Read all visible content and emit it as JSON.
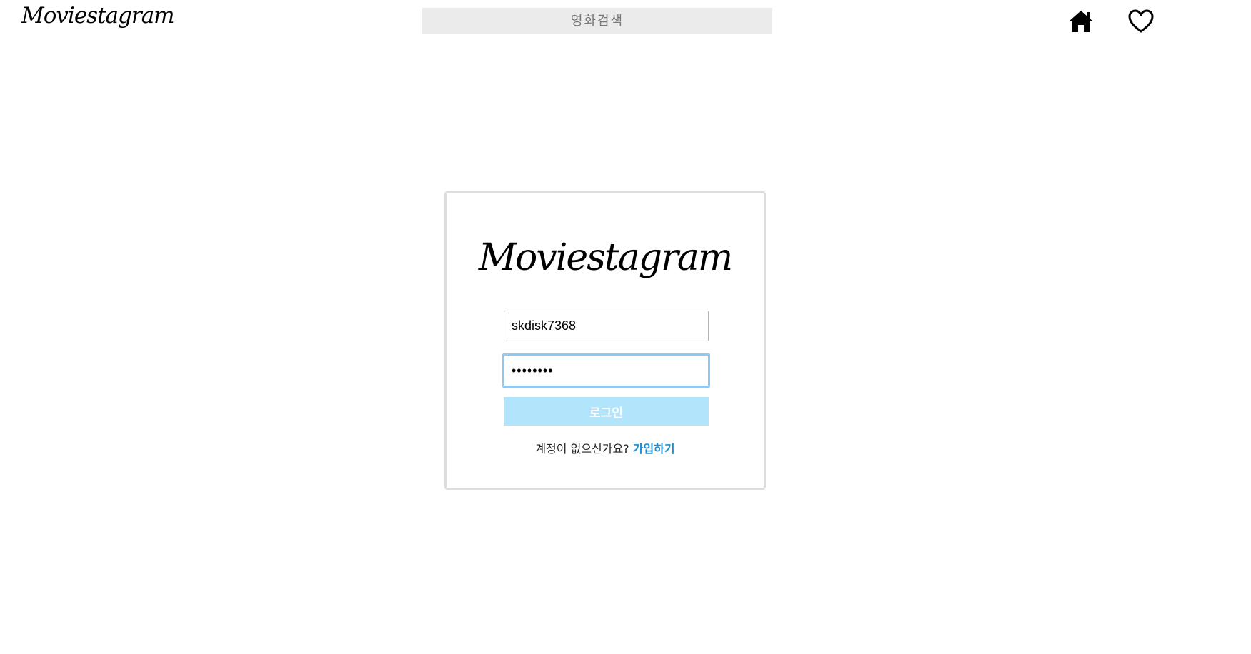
{
  "header": {
    "brand": "Moviestagram",
    "search_placeholder": "영화검색",
    "icons": [
      "home-icon",
      "heart-icon"
    ]
  },
  "login": {
    "brand": "Moviestagram",
    "username_value": "skdisk7368",
    "password_value": "••••••••",
    "login_label": "로그인",
    "signup_prompt": "계정이 없으신가요?",
    "signup_link": "가입하기"
  },
  "colors": {
    "search_bg": "#ebebeb",
    "login_button_bg": "#b2e4fb",
    "link": "#1a8fd6",
    "focus_border": "#8fc8f2",
    "card_border": "#dddddd"
  }
}
